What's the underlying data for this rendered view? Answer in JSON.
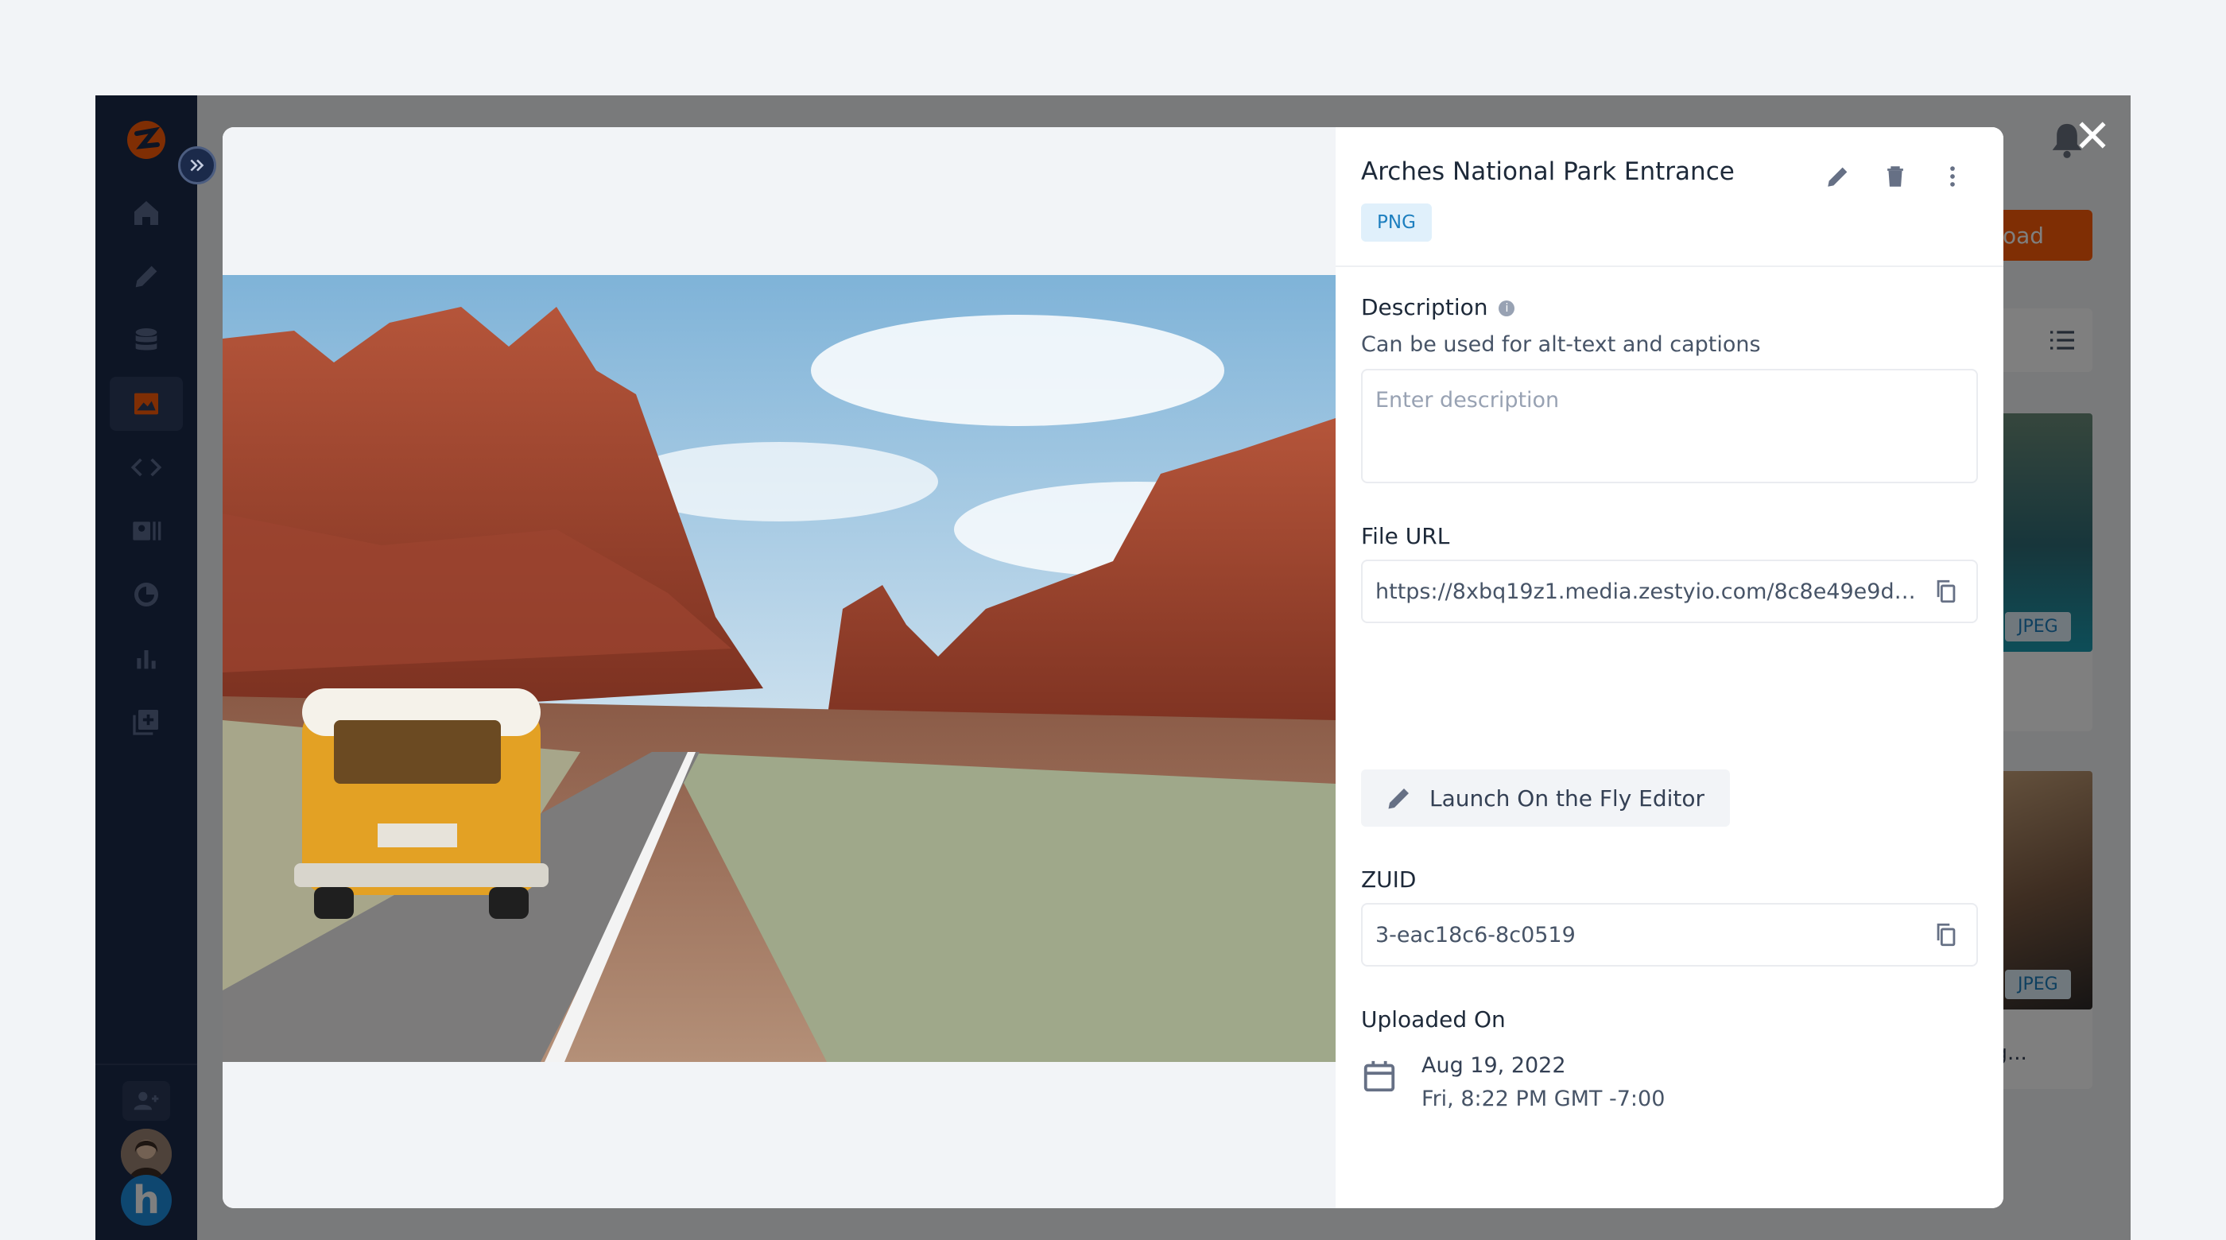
{
  "app": {
    "upload_label": "Upload",
    "background_tags": [
      "JPEG",
      "JPEG"
    ],
    "background_caption": "ng...",
    "colors": {
      "sidebar": "#1b2a4a",
      "accent": "#ff5c08"
    }
  },
  "sidebar": {
    "items": [
      {
        "icon": "home-icon"
      },
      {
        "icon": "pencil-icon"
      },
      {
        "icon": "database-icon"
      },
      {
        "icon": "image-icon",
        "active": true
      },
      {
        "icon": "code-icon"
      },
      {
        "icon": "leads-icon"
      },
      {
        "icon": "history-icon"
      },
      {
        "icon": "analytics-icon"
      },
      {
        "icon": "add-app-icon"
      }
    ],
    "hubspot_letter": "h"
  },
  "modal": {
    "file_title": "Arches National Park Entrance",
    "file_type": "PNG",
    "description": {
      "label": "Description",
      "helper": "Can be used for alt-text and captions",
      "placeholder": "Enter description"
    },
    "file_url": {
      "label": "File URL",
      "value": "https://8xbq19z1.media.zestyio.com/8c8e49e9dd2..."
    },
    "launch_editor_label": "Launch On the Fly Editor",
    "zuid": {
      "label": "ZUID",
      "value": "3-eac18c6-8c0519"
    },
    "uploaded": {
      "label": "Uploaded On",
      "date": "Aug 19, 2022",
      "time": "Fri, 8:22 PM GMT -7:00"
    }
  }
}
